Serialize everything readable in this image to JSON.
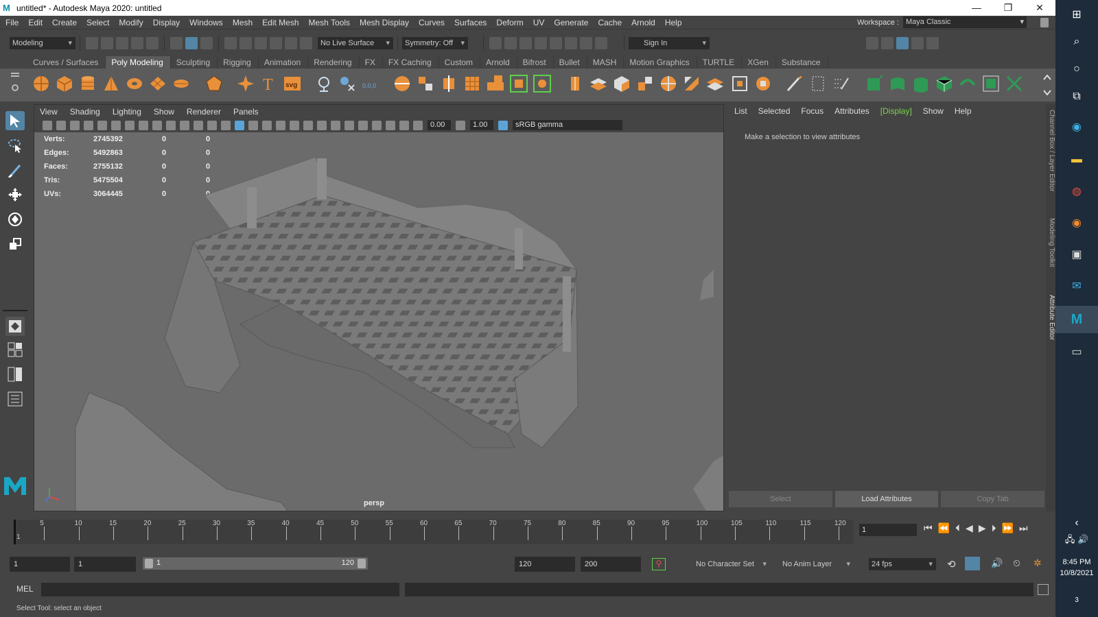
{
  "window": {
    "title": "untitled* - Autodesk Maya 2020: untitled"
  },
  "menubar": {
    "items": [
      "File",
      "Edit",
      "Create",
      "Select",
      "Modify",
      "Display",
      "Windows",
      "Mesh",
      "Edit Mesh",
      "Mesh Tools",
      "Mesh Display",
      "Curves",
      "Surfaces",
      "Deform",
      "UV",
      "Generate",
      "Cache",
      "Arnold",
      "Help"
    ],
    "workspace_label": "Workspace :",
    "workspace_value": "Maya Classic"
  },
  "statusline": {
    "mode": "Modeling",
    "live_surface": "No Live Surface",
    "symmetry": "Symmetry: Off",
    "sign_in": "Sign In"
  },
  "shelf": {
    "tabs": [
      "Curves / Surfaces",
      "Poly Modeling",
      "Sculpting",
      "Rigging",
      "Animation",
      "Rendering",
      "FX",
      "FX Caching",
      "Custom",
      "Arnold",
      "Bifrost",
      "Bullet",
      "MASH",
      "Motion Graphics",
      "TURTLE",
      "XGen",
      "Substance"
    ],
    "active_tab": "Poly Modeling"
  },
  "viewport": {
    "menu": [
      "View",
      "Shading",
      "Lighting",
      "Show",
      "Renderer",
      "Panels"
    ],
    "exposure": "0.00",
    "gamma": "1.00",
    "color_space": "sRGB gamma",
    "camera": "persp",
    "hud": [
      {
        "label": "Verts:",
        "v1": "2745392",
        "v2": "0",
        "v3": "0"
      },
      {
        "label": "Edges:",
        "v1": "5492863",
        "v2": "0",
        "v3": "0"
      },
      {
        "label": "Faces:",
        "v1": "2755132",
        "v2": "0",
        "v3": "0"
      },
      {
        "label": "Tris:",
        "v1": "5475504",
        "v2": "0",
        "v3": "0"
      },
      {
        "label": "UVs:",
        "v1": "3064445",
        "v2": "0",
        "v3": "0"
      }
    ]
  },
  "attribute_editor": {
    "menu": [
      "List",
      "Selected",
      "Focus",
      "Attributes",
      "[Display]",
      "Show",
      "Help"
    ],
    "message": "Make a selection to view attributes",
    "buttons": [
      "Select",
      "Load Attributes",
      "Copy Tab"
    ],
    "side_tabs": [
      "Channel Box / Layer Editor",
      "Modeling Toolkit",
      "Attribute Editor"
    ]
  },
  "timeslider": {
    "ticks": [
      "5",
      "10",
      "15",
      "20",
      "25",
      "30",
      "35",
      "40",
      "45",
      "50",
      "55",
      "60",
      "65",
      "70",
      "75",
      "80",
      "85",
      "90",
      "95",
      "100",
      "105",
      "110",
      "115",
      "120"
    ],
    "start_label": "1",
    "current_frame": "1"
  },
  "range": {
    "start": "1",
    "playback_start": "1",
    "slider_start": "1",
    "slider_end": "120",
    "playback_end": "120",
    "end": "200",
    "character_set": "No Character Set",
    "anim_layer": "No Anim Layer",
    "fps": "24 fps"
  },
  "commandline": {
    "label": "MEL",
    "help": "Select Tool: select an object"
  },
  "taskbar": {
    "time": "8:45 PM",
    "date": "10/8/2021",
    "notifications": "3"
  },
  "colors": {
    "maya_bg": "#444444",
    "viewport_bg": "#6b6b6b",
    "active_tool": "#5285a6",
    "display_green": "#7bd34f",
    "taskbar": "#1d2b3a"
  }
}
